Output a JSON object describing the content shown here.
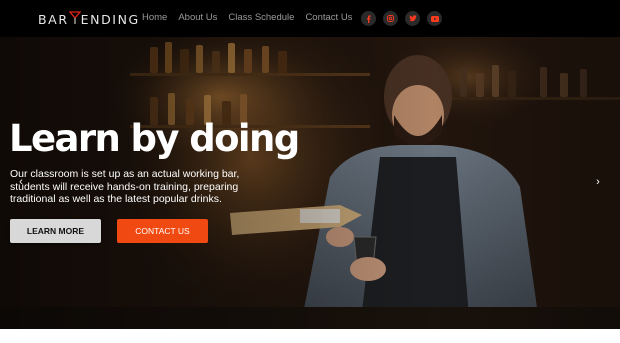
{
  "brand": {
    "logo_left": "BAR",
    "logo_right": "ENDING",
    "accent": "#e0241b"
  },
  "nav": {
    "items": [
      {
        "label": "Home"
      },
      {
        "label": "About Us"
      },
      {
        "label": "Class Schedule"
      },
      {
        "label": "Contact Us"
      }
    ]
  },
  "socials": [
    {
      "icon": "facebook-icon",
      "glyph": "f"
    },
    {
      "icon": "instagram-icon",
      "glyph": "◎"
    },
    {
      "icon": "twitter-icon",
      "glyph": "t"
    },
    {
      "icon": "youtube-icon",
      "glyph": "▶"
    }
  ],
  "hero": {
    "headline": "Learn by doing",
    "subtext": "Our classroom is set up as an actual working bar, students will receive hands-on training, preparing traditional as well as the latest popular drinks.",
    "learn_more": "LEARN MORE",
    "contact_us": "CONTACT US",
    "prev_arrow": "‹",
    "next_arrow": "›"
  },
  "colors": {
    "accent": "#f04a12",
    "nav_bg": "#000000",
    "nav_text": "#9a9a9a",
    "social_icon": "#ff3b1f"
  }
}
